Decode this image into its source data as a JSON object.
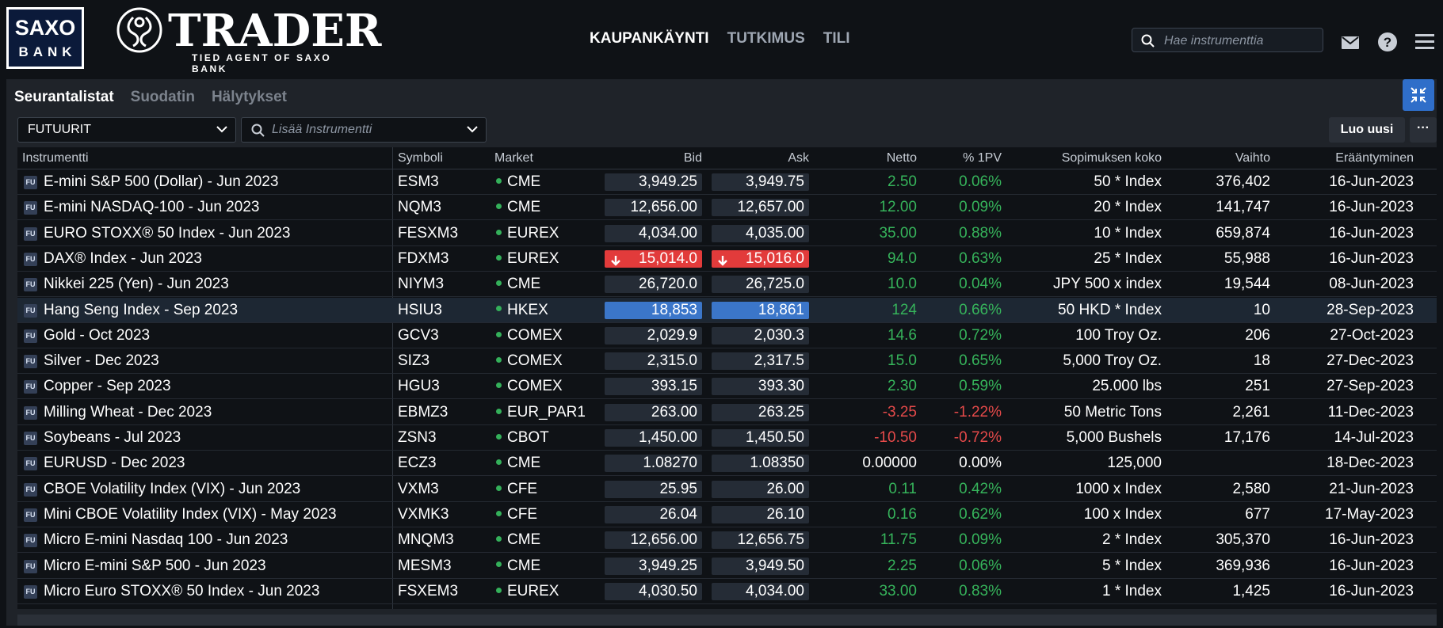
{
  "logos": {
    "saxo_line1": "SAXO",
    "saxo_line2": "BANK",
    "trader_word": "TRADER",
    "trader_sub": "TIED AGENT OF SAXO BANK"
  },
  "nav": [
    "KAUPANKÄYNTI",
    "TUTKIMUS",
    "TILI"
  ],
  "search": {
    "placeholder": "Hae instrumenttia"
  },
  "panel_tabs": [
    "Seurantalistat",
    "Suodatin",
    "Hälytykset"
  ],
  "watchlist_select": "FUTUURIT",
  "add_instrument": {
    "placeholder": "Lisää Instrumentti"
  },
  "create_button": "Luo uusi",
  "more_button": "···",
  "columns": {
    "instrument": "Instrumentti",
    "symbol": "Symboli",
    "market": "Market",
    "bid": "Bid",
    "ask": "Ask",
    "net": "Netto",
    "pct": "% 1PV",
    "size": "Sopimuksen koko",
    "volume": "Vaihto",
    "expiry": "Erääntyminen"
  },
  "asset_badge": "FU",
  "colors": {
    "positive": "#36b45b",
    "negative": "#e64a4a",
    "highlight_up": "#3b76c9",
    "highlight_down": "#e23b3b",
    "accent": "#2f6ec9"
  },
  "rows": [
    {
      "instrument": "E-mini S&P 500 (Dollar) - Jun 2023",
      "symbol": "ESM3",
      "market": "CME",
      "bid": "3,949.25",
      "ask": "3,949.75",
      "net": "2.50",
      "pct": "0.06%",
      "size": "50 * Index",
      "volume": "376,402",
      "expiry": "16-Jun-2023",
      "dir": "pos",
      "flash": ""
    },
    {
      "instrument": "E-mini NASDAQ-100 - Jun 2023",
      "symbol": "NQM3",
      "market": "CME",
      "bid": "12,656.00",
      "ask": "12,657.00",
      "net": "12.00",
      "pct": "0.09%",
      "size": "20 * Index",
      "volume": "141,747",
      "expiry": "16-Jun-2023",
      "dir": "pos",
      "flash": ""
    },
    {
      "instrument": "EURO STOXX® 50 Index - Jun 2023",
      "symbol": "FESXM3",
      "market": "EUREX",
      "bid": "4,034.00",
      "ask": "4,035.00",
      "net": "35.00",
      "pct": "0.88%",
      "size": "10 * Index",
      "volume": "659,874",
      "expiry": "16-Jun-2023",
      "dir": "pos",
      "flash": ""
    },
    {
      "instrument": "DAX® Index - Jun 2023",
      "symbol": "FDXM3",
      "market": "EUREX",
      "bid": "15,014.0",
      "ask": "15,016.0",
      "net": "94.0",
      "pct": "0.63%",
      "size": "25 * Index",
      "volume": "55,988",
      "expiry": "16-Jun-2023",
      "dir": "pos",
      "flash": "down"
    },
    {
      "instrument": "Nikkei 225 (Yen) - Jun 2023",
      "symbol": "NIYM3",
      "market": "CME",
      "bid": "26,720.0",
      "ask": "26,725.0",
      "net": "10.0",
      "pct": "0.04%",
      "size": "JPY 500 x index",
      "volume": "19,544",
      "expiry": "08-Jun-2023",
      "dir": "pos",
      "flash": ""
    },
    {
      "instrument": "Hang Seng Index - Sep 2023",
      "symbol": "HSIU3",
      "market": "HKEX",
      "bid": "18,853",
      "ask": "18,861",
      "net": "124",
      "pct": "0.66%",
      "size": "50 HKD * Index",
      "volume": "10",
      "expiry": "28-Sep-2023",
      "dir": "pos",
      "flash": "up"
    },
    {
      "instrument": "Gold - Oct 2023",
      "symbol": "GCV3",
      "market": "COMEX",
      "bid": "2,029.9",
      "ask": "2,030.3",
      "net": "14.6",
      "pct": "0.72%",
      "size": "100 Troy Oz.",
      "volume": "206",
      "expiry": "27-Oct-2023",
      "dir": "pos",
      "flash": ""
    },
    {
      "instrument": "Silver - Dec 2023",
      "symbol": "SIZ3",
      "market": "COMEX",
      "bid": "2,315.0",
      "ask": "2,317.5",
      "net": "15.0",
      "pct": "0.65%",
      "size": "5,000 Troy Oz.",
      "volume": "18",
      "expiry": "27-Dec-2023",
      "dir": "pos",
      "flash": ""
    },
    {
      "instrument": "Copper - Sep 2023",
      "symbol": "HGU3",
      "market": "COMEX",
      "bid": "393.15",
      "ask": "393.30",
      "net": "2.30",
      "pct": "0.59%",
      "size": "25.000 lbs",
      "volume": "251",
      "expiry": "27-Sep-2023",
      "dir": "pos",
      "flash": ""
    },
    {
      "instrument": "Milling Wheat - Dec 2023",
      "symbol": "EBMZ3",
      "market": "EUR_PAR1",
      "bid": "263.00",
      "ask": "263.25",
      "net": "-3.25",
      "pct": "-1.22%",
      "size": "50 Metric Tons",
      "volume": "2,261",
      "expiry": "11-Dec-2023",
      "dir": "neg",
      "flash": ""
    },
    {
      "instrument": "Soybeans - Jul 2023",
      "symbol": "ZSN3",
      "market": "CBOT",
      "bid": "1,450.00",
      "ask": "1,450.50",
      "net": "-10.50",
      "pct": "-0.72%",
      "size": "5,000 Bushels",
      "volume": "17,176",
      "expiry": "14-Jul-2023",
      "dir": "neg",
      "flash": ""
    },
    {
      "instrument": "EURUSD - Dec 2023",
      "symbol": "ECZ3",
      "market": "CME",
      "bid": "1.08270",
      "ask": "1.08350",
      "net": "0.00000",
      "pct": "0.00%",
      "size": "125,000",
      "volume": "",
      "expiry": "18-Dec-2023",
      "dir": "neu",
      "flash": ""
    },
    {
      "instrument": "CBOE Volatility Index (VIX) - Jun 2023",
      "symbol": "VXM3",
      "market": "CFE",
      "bid": "25.95",
      "ask": "26.00",
      "net": "0.11",
      "pct": "0.42%",
      "size": "1000 x Index",
      "volume": "2,580",
      "expiry": "21-Jun-2023",
      "dir": "pos",
      "flash": ""
    },
    {
      "instrument": "Mini CBOE Volatility Index (VIX) - May 2023",
      "symbol": "VXMK3",
      "market": "CFE",
      "bid": "26.04",
      "ask": "26.10",
      "net": "0.16",
      "pct": "0.62%",
      "size": "100 x Index",
      "volume": "677",
      "expiry": "17-May-2023",
      "dir": "pos",
      "flash": ""
    },
    {
      "instrument": "Micro E-mini Nasdaq 100 - Jun 2023",
      "symbol": "MNQM3",
      "market": "CME",
      "bid": "12,656.00",
      "ask": "12,656.75",
      "net": "11.75",
      "pct": "0.09%",
      "size": "2 * Index",
      "volume": "305,370",
      "expiry": "16-Jun-2023",
      "dir": "pos",
      "flash": ""
    },
    {
      "instrument": "Micro E-mini S&P 500 - Jun 2023",
      "symbol": "MESM3",
      "market": "CME",
      "bid": "3,949.25",
      "ask": "3,949.50",
      "net": "2.25",
      "pct": "0.06%",
      "size": "5 * Index",
      "volume": "369,936",
      "expiry": "16-Jun-2023",
      "dir": "pos",
      "flash": ""
    },
    {
      "instrument": "Micro Euro STOXX® 50 Index - Jun 2023",
      "symbol": "FSXEM3",
      "market": "EUREX",
      "bid": "4,030.50",
      "ask": "4,034.00",
      "net": "33.00",
      "pct": "0.83%",
      "size": "1 * Index",
      "volume": "1,425",
      "expiry": "16-Jun-2023",
      "dir": "pos",
      "flash": ""
    }
  ]
}
